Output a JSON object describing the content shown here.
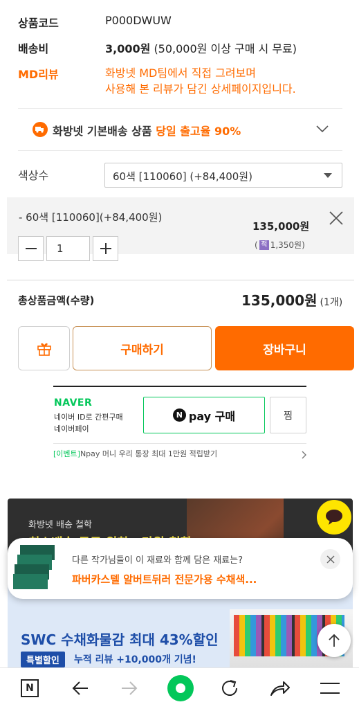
{
  "product": {
    "code_label": "상품코드",
    "code_value": "P000DWUW",
    "shipping_label": "배송비",
    "shipping_value_bold": "3,000원",
    "shipping_value_note": "(50,000원 이상 구매 시 무료)",
    "md_label": "MD리뷰",
    "md_line1": "화방넷 MD팀에서 직접 그려보며",
    "md_line2": "사용해 본 리뷰가 담긴 상세페이지입니다."
  },
  "delivery_banner": {
    "text": "화방넷 기본배송 상품",
    "highlight": "당일 출고율 90%"
  },
  "option": {
    "label": "색상수",
    "selected": "60색 [110060] (+84,400원)"
  },
  "selected_item": {
    "name": "- 60색 [110060](+84,400원)",
    "quantity": "1",
    "price": "135,000원",
    "points_prefix": "(",
    "points_icon": "적",
    "points": "1,350원)"
  },
  "total": {
    "label": "총상품금액(수량)",
    "value": "135,000원",
    "count": "(1개)"
  },
  "buttons": {
    "buy": "구매하기",
    "cart": "장바구니"
  },
  "naver": {
    "logo": "NAVER",
    "line1": "네이버 ID로 간편구매",
    "line2": "네이버페이",
    "pay_label": "pay 구매",
    "pay_n": "N",
    "wish": "찜",
    "event_tag": "[이벤트]",
    "event_text": "Npay 머니 우리 통장 최대 1만원 적립받기"
  },
  "banner": {
    "small": "화방넷 배송 철학",
    "headline": "최소배송 무료 위한 3만원 철학",
    "promo_title": "SWC 수채화물감 최대 43%할인",
    "promo_tag": "특별할인",
    "promo_sub": "누적 리뷰 +10,000개 기념!"
  },
  "popup": {
    "question": "다른 작가님들이 이 재료와 함께 담은 재료는?",
    "product": "파버카스텔 알버트뒤러 전문가용 수채색..."
  },
  "colors": {
    "accent": "#ff6b00",
    "naver_green": "#03c75a"
  },
  "nav_icons": [
    "n-home-icon",
    "back-icon",
    "forward-icon",
    "green-dot-icon",
    "refresh-icon",
    "share-icon",
    "menu-icon"
  ]
}
